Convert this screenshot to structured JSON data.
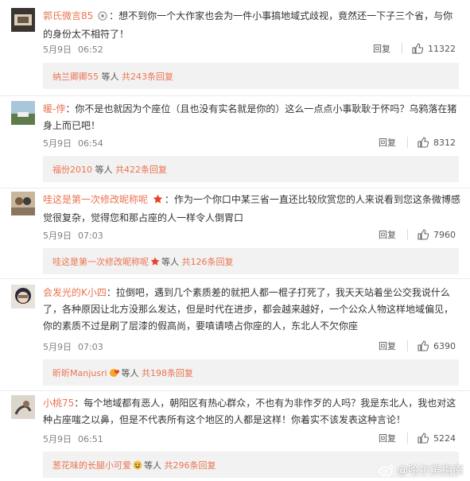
{
  "colors": {
    "username": "#eb7350",
    "meta": "#808080",
    "reply_bg": "#f2f2f2"
  },
  "comments": [
    {
      "username": "郭氏微言85",
      "badge": "medal-icon",
      "sep": "：",
      "text": "想不到你一个大作家也会为一件小事搞地域式歧视，竟然还一下子三个省，与你的身份太不相符了！",
      "date": "5月9日",
      "time": "06:52",
      "reply_label": "回复",
      "likes": "11322",
      "reply_user": "纳兰卿卿55",
      "reply_mid": " 等人 ",
      "reply_count": "共243条回复"
    },
    {
      "username": "暖-侼",
      "badge": "",
      "sep": "：",
      "text": "你不是也就因为个座位（且也没有实名就是你的）这么一点点小事耿耿于怀吗？乌鸦落在猪身上而已吧！",
      "date": "5月9日",
      "time": "06:54",
      "reply_label": "回复",
      "likes": "8312",
      "reply_user": "福份2010",
      "reply_mid": " 等人 ",
      "reply_count": "共422条回复"
    },
    {
      "username": "哇这是第一次修改昵称呢",
      "badge": "star-icon",
      "sep": "：",
      "text": "作为一个你口中某三省一直还比较欣赏您的人来说看到您这条微博感觉很复杂，觉得您和那占座的人一样令人倒胃口",
      "date": "5月9日",
      "time": "07:03",
      "reply_label": "回复",
      "likes": "7960",
      "reply_user": "哇这是第一次修改昵称呢",
      "reply_mid": "等人 ",
      "reply_count": "共126条回复"
    },
    {
      "username": "会发光的K小四",
      "badge": "",
      "sep": "：",
      "text": "拉倒吧，遇到几个素质差的就把人都一棍子打死了，我天天站着坐公交我说什么了，各种原因让北方没那么发达，但是时代在进步，都会越来越好，一个公众人物这样地域偏见，你的素质不过是刷了层漆的假高尚，要嗔请啧占你座的人，东北人不欠你座",
      "date": "5月9日",
      "time": "07:03",
      "reply_label": "回复",
      "likes": "6390",
      "reply_user": "昕昕Manjusri",
      "reply_mid": "等人 ",
      "reply_count": "共198条回复"
    },
    {
      "username": "小桃75",
      "badge": "",
      "sep": "：",
      "text": "每个地域都有恶人，朝阳区有热心群众，不也有为非作歹的人吗？我是东北人，我也对这种占座嗤之以鼻，但是不代表所有这个地区的人都是这样！你着实不该发表这种言论！",
      "date": "5月9日",
      "time": "06:51",
      "reply_label": "回复",
      "likes": "5224",
      "reply_user": "葱花味的长腿小可爱",
      "reply_mid": "等人 ",
      "reply_count": "共296条回复"
    }
  ],
  "watermark": {
    "text": "@哈尔滨指南"
  }
}
